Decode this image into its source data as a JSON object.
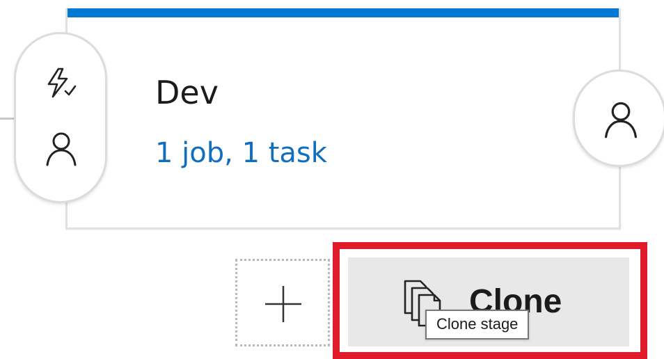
{
  "stage": {
    "title": "Dev",
    "summary": "1 job, 1 task",
    "accent_color": "#0078d4"
  },
  "pre_deployment": {
    "trigger_icon": "lightning-check-icon",
    "approver_icon": "person-icon"
  },
  "post_deployment": {
    "approver_icon": "person-icon"
  },
  "actions": {
    "add_icon": "plus-icon",
    "clone_icon": "copy-documents-icon",
    "clone_label": "Clone",
    "clone_tooltip": "Clone stage"
  },
  "highlight_color": "#e01a2a"
}
